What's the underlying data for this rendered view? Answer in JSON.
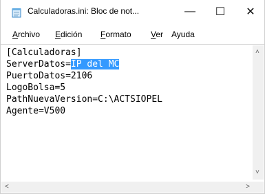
{
  "window": {
    "title": "Calculadoras.ini: Bloc de not...",
    "controls": {
      "minimize": "—",
      "maximize": "☐",
      "close": "✕"
    }
  },
  "menu": {
    "items": [
      {
        "first": "A",
        "rest": "rchivo"
      },
      {
        "first": "E",
        "rest": "dición"
      },
      {
        "first": "F",
        "rest": "ormato"
      },
      {
        "first": "V",
        "rest": "er"
      },
      {
        "first": "",
        "rest": "Ayuda"
      }
    ]
  },
  "document": {
    "lines": [
      "[Calculadoras]",
      "ServerDatos=",
      "PuertoDatos=2106",
      "LogoBolsa=5",
      "PathNuevaVersion=C:\\ACTSIOPEL",
      "Agente=V500"
    ],
    "selected_text": "IP del MC",
    "selected_line_index": 1
  },
  "scrollbars": {
    "up": "˄",
    "down": "˅",
    "left": "<",
    "right": ">"
  }
}
